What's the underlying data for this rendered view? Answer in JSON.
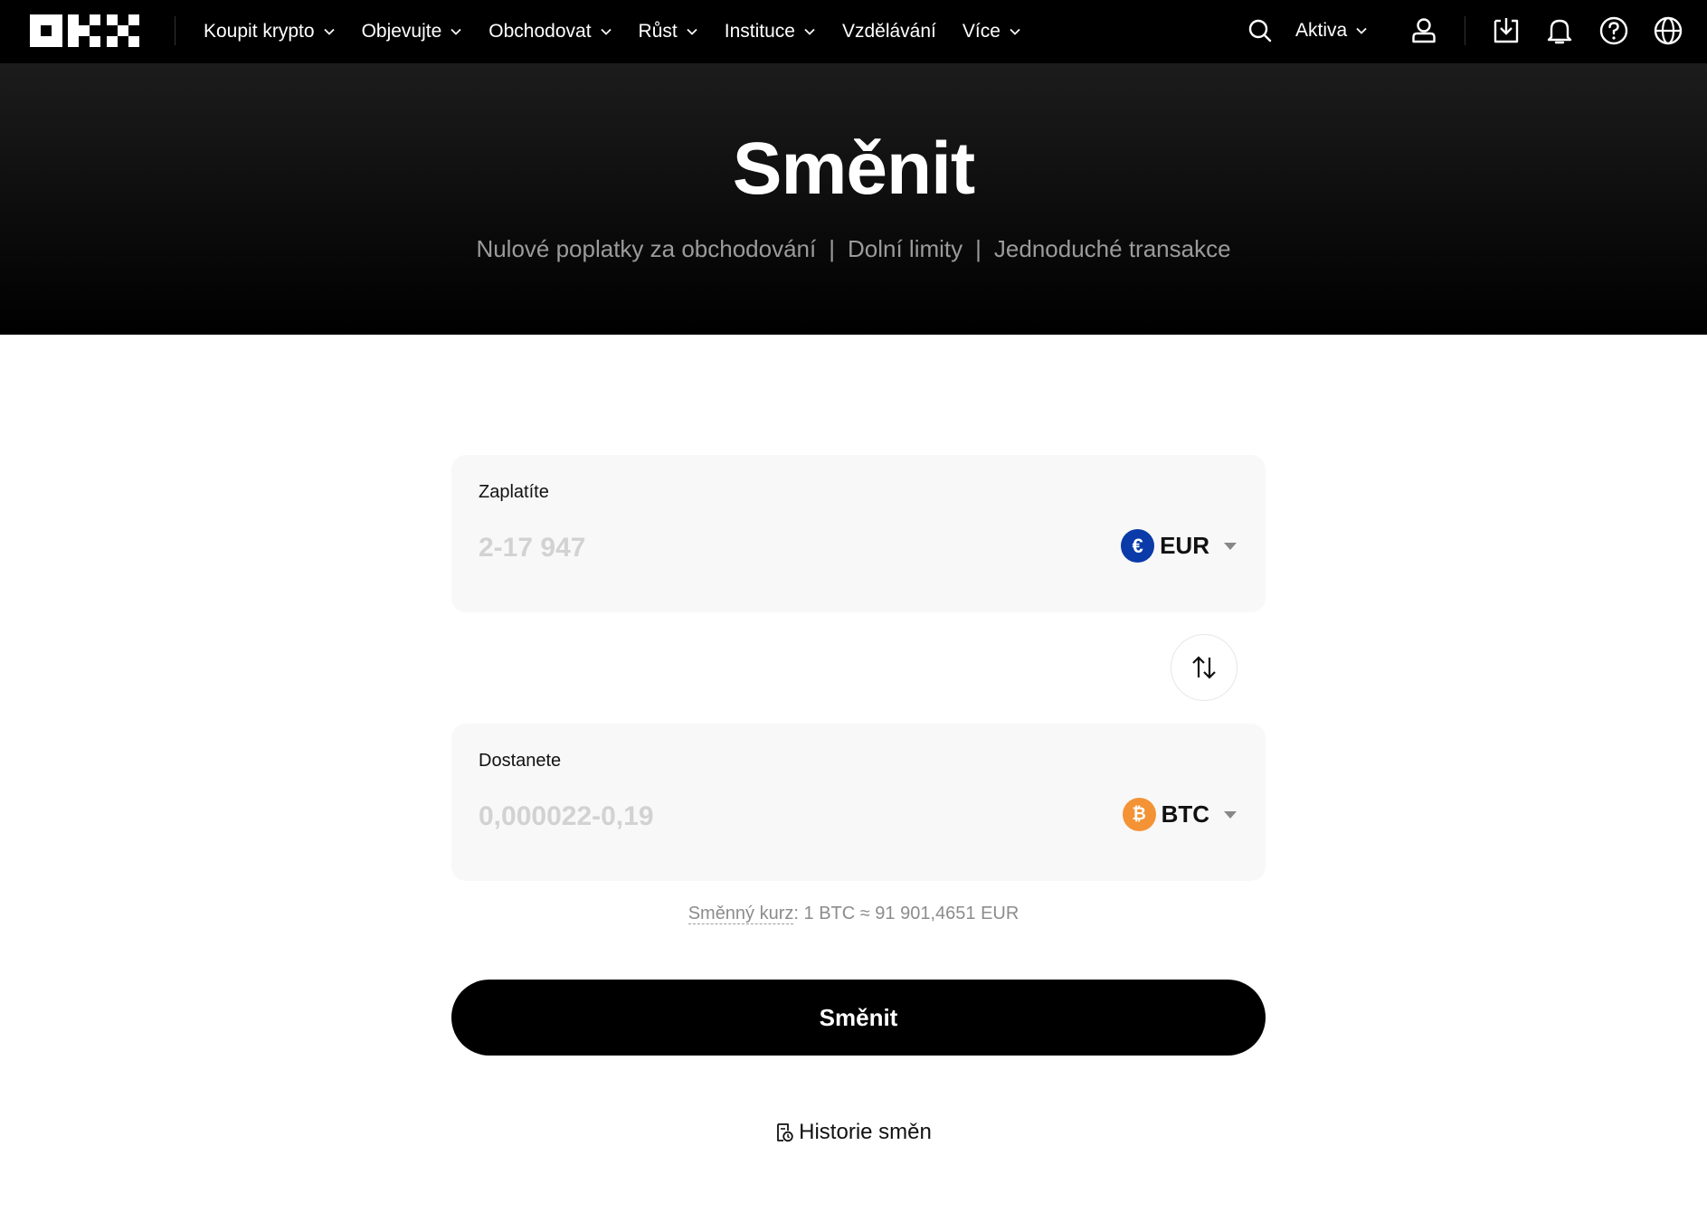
{
  "nav": {
    "items": [
      {
        "label": "Koupit krypto",
        "dropdown": true
      },
      {
        "label": "Objevujte",
        "dropdown": true
      },
      {
        "label": "Obchodovat",
        "dropdown": true
      },
      {
        "label": "Růst",
        "dropdown": true
      },
      {
        "label": "Instituce",
        "dropdown": true
      },
      {
        "label": "Vzdělávání",
        "dropdown": false
      },
      {
        "label": "Více",
        "dropdown": true
      }
    ],
    "assets_label": "Aktiva",
    "icons": [
      "search-icon",
      "user-icon",
      "download-icon",
      "bell-icon",
      "help-icon",
      "globe-icon"
    ]
  },
  "hero": {
    "title": "Směnit",
    "features": [
      "Nulové poplatky za obchodování",
      "Dolní limity",
      "Jednoduché transakce"
    ],
    "separator": "|"
  },
  "pay": {
    "label": "Zaplatíte",
    "placeholder": "2-17 947",
    "currency": "EUR",
    "currency_symbol": "€",
    "currency_color": "#0a3ba8"
  },
  "receive": {
    "label": "Dostanete",
    "placeholder": "0,000022-0,19",
    "currency": "BTC",
    "currency_symbol": "₿",
    "currency_color": "#f39336"
  },
  "rate": {
    "label": "Směnný kurz",
    "value": ": 1 BTC ≈ 91 901,4651 EUR"
  },
  "cta_label": "Směnit",
  "history_label": "Historie směn"
}
